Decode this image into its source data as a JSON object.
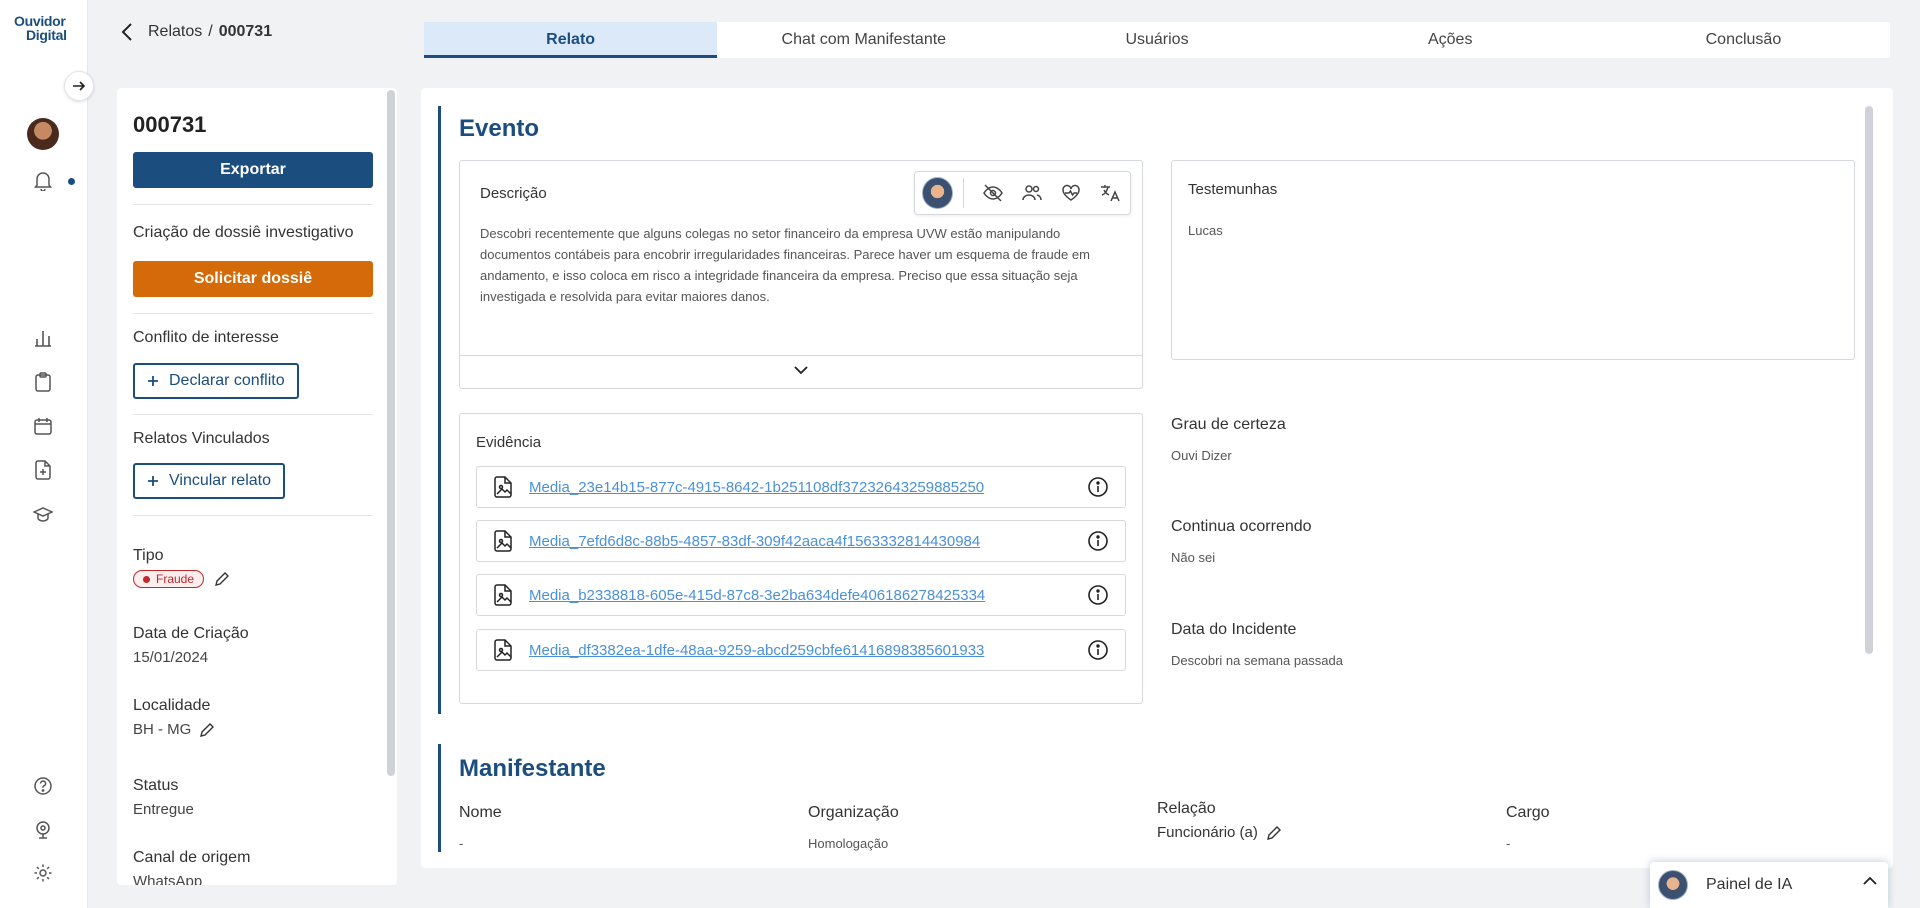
{
  "logo": {
    "line1": "Ouvidor",
    "line2": "Digital"
  },
  "breadcrumb": {
    "parent": "Relatos",
    "separator": "/",
    "current": "000731"
  },
  "tabs": [
    {
      "label": "Relato",
      "active": true
    },
    {
      "label": "Chat com Manifestante",
      "active": false
    },
    {
      "label": "Usuários",
      "active": false
    },
    {
      "label": "Ações",
      "active": false
    },
    {
      "label": "Conclusão",
      "active": false
    }
  ],
  "left": {
    "id": "000731",
    "export_label": "Exportar",
    "dossier_label": "Criação de dossiê investigativo",
    "dossier_button": "Solicitar dossiê",
    "conflict_label": "Conflito de interesse",
    "conflict_button": "Declarar conflito",
    "linked_label": "Relatos Vinculados",
    "linked_button": "Vincular relato",
    "tipo_label": "Tipo",
    "tipo_value": "Fraude",
    "created_label": "Data de Criação",
    "created_value": "15/01/2024",
    "locality_label": "Localidade",
    "locality_value": "BH - MG",
    "status_label": "Status",
    "status_value": "Entregue",
    "channel_label": "Canal de origem",
    "channel_value": "WhatsApp"
  },
  "evento": {
    "title": "Evento",
    "descricao_label": "Descrição",
    "descricao_text": "Descobri recentemente que alguns colegas no setor financeiro da empresa UVW estão manipulando documentos contábeis para encobrir irregularidades financeiras. Parece haver um esquema de fraude em andamento, e isso coloca em risco a integridade financeira da empresa. Preciso que essa situação seja investigada e resolvida para evitar maiores danos.",
    "testemunhas_label": "Testemunhas",
    "testemunhas_value": "Lucas",
    "evidencia_label": "Evidência",
    "evidencias": [
      "Media_23e14b15-877c-4915-8642-1b251108df37232643259885250",
      "Media_7efd6d8c-88b5-4857-83df-309f42aaca4f1563332814430984",
      "Media_b2338818-605e-415d-87c8-3e2ba634defe406186278425334",
      "Media_df3382ea-1dfe-48aa-9259-abcd259cbfe61416898385601933"
    ],
    "certeza_label": "Grau de certeza",
    "certeza_value": "Ouvi Dizer",
    "continua_label": "Continua ocorrendo",
    "continua_value": "Não sei",
    "data_label": "Data do Incidente",
    "data_value": "Descobri na semana passada"
  },
  "manifestante": {
    "title": "Manifestante",
    "nome_label": "Nome",
    "nome_value": "-",
    "org_label": "Organização",
    "org_value": "Homologação",
    "relacao_label": "Relação",
    "relacao_value": "Funcionário (a)",
    "cargo_label": "Cargo",
    "cargo_value": "-"
  },
  "ai_panel": {
    "label": "Painel de IA"
  },
  "colors": {
    "primary": "#1b4e7f",
    "orange": "#d56b08",
    "danger": "#c0282d",
    "link": "#4a90d9"
  },
  "icons": [
    "arrow-right-icon",
    "bell-icon",
    "bar-chart-icon",
    "clipboard-icon",
    "calendar-icon",
    "file-plus-icon",
    "graduation-cap-icon",
    "help-icon",
    "webcam-icon",
    "gear-icon",
    "eye-off-icon",
    "users-icon",
    "heart-pulse-icon",
    "translate-icon",
    "file-image-icon",
    "info-icon",
    "chevron-down-icon",
    "chevron-up-icon",
    "pencil-icon",
    "chevron-left-icon",
    "plus-icon"
  ]
}
